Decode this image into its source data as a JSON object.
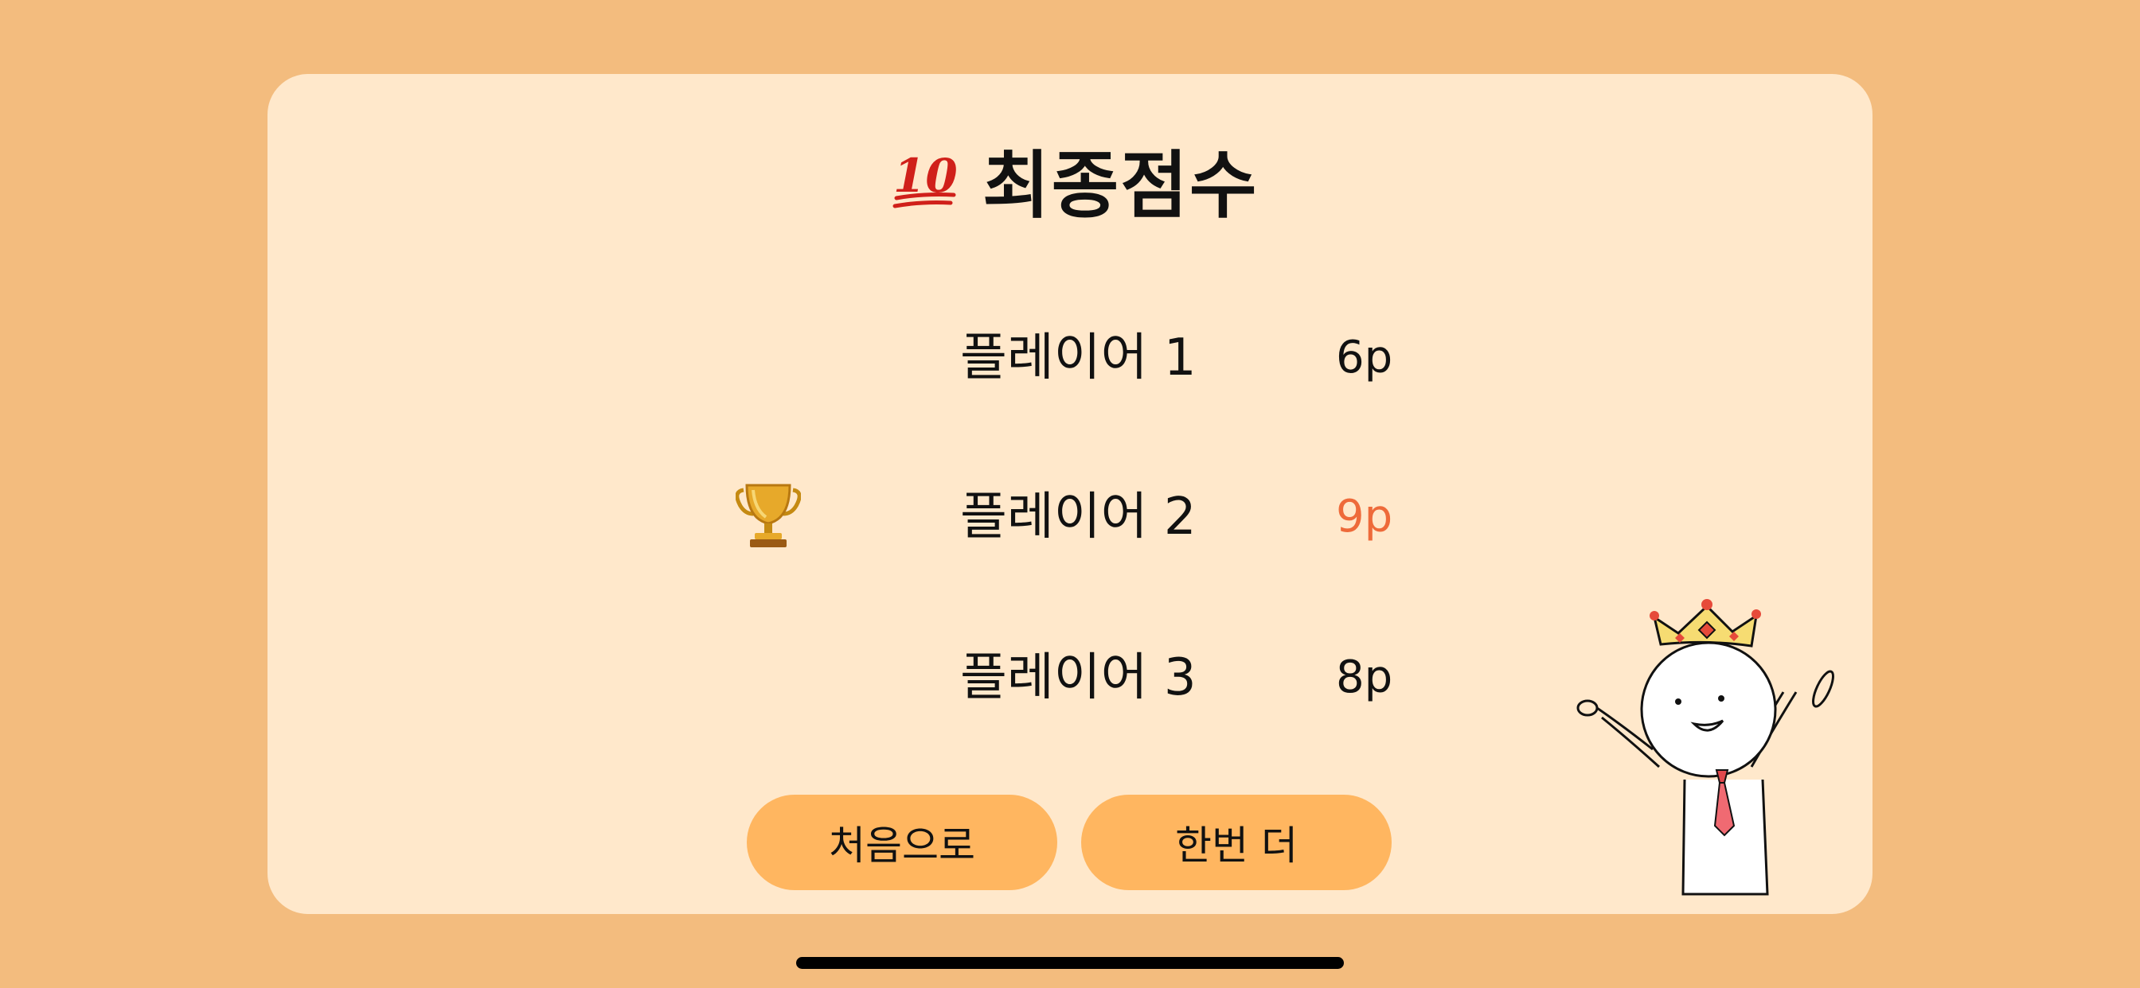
{
  "header": {
    "icon": "hundred-points-icon",
    "title": "최종점수"
  },
  "players": [
    {
      "name": "플레이어 1",
      "score": "6p",
      "winner": false
    },
    {
      "name": "플레이어 2",
      "score": "9p",
      "winner": true
    },
    {
      "name": "플레이어 3",
      "score": "8p",
      "winner": false
    }
  ],
  "buttons": {
    "home_label": "처음으로",
    "replay_label": "한번 더"
  },
  "icons": {
    "trophy": "trophy-icon",
    "mascot": "crowned-mascot-illustration"
  },
  "colors": {
    "background": "#F3BC7E",
    "card": "#FFE8CB",
    "button": "#FFB660",
    "winner_score": "#EE6A3A"
  }
}
